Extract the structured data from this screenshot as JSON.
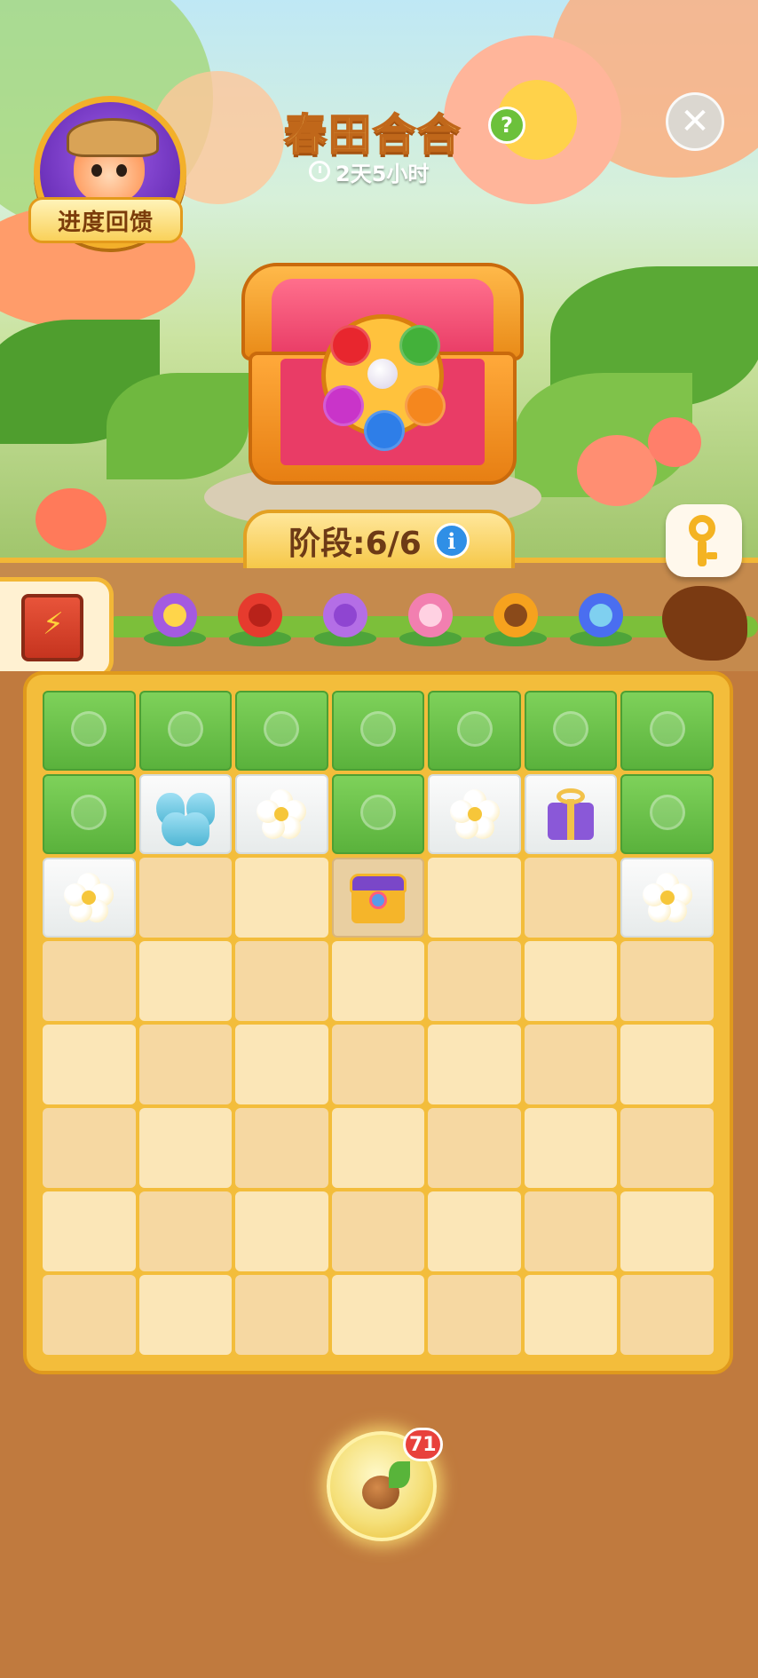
{
  "header": {
    "title": "春田合合",
    "timer": "2天5小时",
    "progress_label": "进度回馈",
    "help_symbol": "?",
    "close_symbol": "✕"
  },
  "stage": {
    "label": "阶段:6/6",
    "info_symbol": "i",
    "current": 6,
    "total": 6
  },
  "flower_track": [
    {
      "name": "pansy",
      "color": "#a45ae0",
      "center": "#ffd54a"
    },
    {
      "name": "rose",
      "color": "#e63b2e",
      "center": "#b8221a"
    },
    {
      "name": "hydrangea",
      "color": "#b46ee6",
      "center": "#8f45d1"
    },
    {
      "name": "peony",
      "color": "#f27fb0",
      "center": "#ffd1e2"
    },
    {
      "name": "sunflower",
      "color": "#f6a21e",
      "center": "#8a4a1a"
    },
    {
      "name": "aster",
      "color": "#4a6ef0",
      "center": "#7fd0f0"
    },
    {
      "name": "locked-flower",
      "color": "#7a3a12",
      "center": "#7a3a12"
    }
  ],
  "board": {
    "columns": 7,
    "rows": 8,
    "cells": [
      [
        "leaf",
        "leaf",
        "leaf",
        "leaf",
        "leaf",
        "leaf",
        "leaf"
      ],
      [
        "leaf",
        "butterfly",
        "plumeria",
        "leaf",
        "plumeria",
        "gift",
        "leaf"
      ],
      [
        "plumeria",
        "empty",
        "empty",
        "chest",
        "empty",
        "empty",
        "plumeria"
      ],
      [
        "empty",
        "empty",
        "empty",
        "empty",
        "empty",
        "empty",
        "empty"
      ],
      [
        "empty",
        "empty",
        "empty",
        "empty",
        "empty",
        "empty",
        "empty"
      ],
      [
        "empty",
        "empty",
        "empty",
        "empty",
        "empty",
        "empty",
        "empty"
      ],
      [
        "empty",
        "empty",
        "empty",
        "empty",
        "empty",
        "empty",
        "empty"
      ],
      [
        "empty",
        "empty",
        "empty",
        "empty",
        "empty",
        "empty",
        "empty"
      ]
    ]
  },
  "seed": {
    "count": "71"
  },
  "colors": {
    "board_frame": "#f3bd3b",
    "background": "#c07a3e",
    "title_fill": "#ffe07a"
  }
}
